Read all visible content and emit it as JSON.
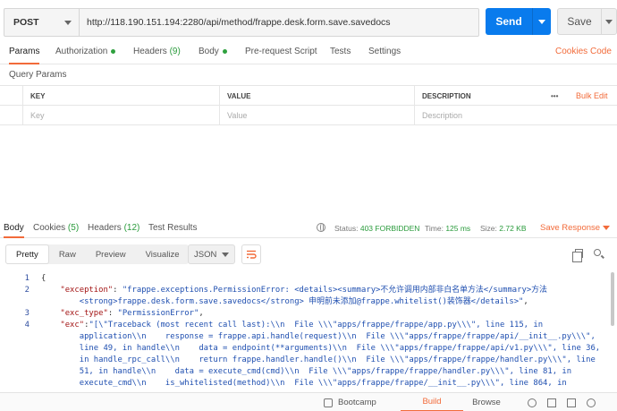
{
  "request": {
    "method": "POST",
    "url": "http://118.190.151.194:2280/api/method/frappe.desk.form.save.savedocs",
    "send_label": "Send",
    "save_label": "Save"
  },
  "request_tabs": [
    {
      "label": "Params",
      "count": "",
      "dot": false
    },
    {
      "label": "Authorization",
      "count": "",
      "dot": true
    },
    {
      "label": "Headers",
      "count": "(9)",
      "dot": false
    },
    {
      "label": "Body",
      "count": "",
      "dot": true
    },
    {
      "label": "Pre-request Script",
      "count": "",
      "dot": false
    },
    {
      "label": "Tests",
      "count": "",
      "dot": false
    },
    {
      "label": "Settings",
      "count": "",
      "dot": false
    }
  ],
  "request_links": {
    "cookies": "Cookies",
    "code": "Code"
  },
  "query_params": {
    "section_label": "Query Params",
    "headers": {
      "key": "KEY",
      "value": "VALUE",
      "description": "DESCRIPTION",
      "more": "•••",
      "bulk_edit": "Bulk Edit"
    },
    "placeholders": {
      "key": "Key",
      "value": "Value",
      "description": "Description"
    }
  },
  "response_tabs": [
    {
      "label": "Body",
      "count": ""
    },
    {
      "label": "Cookies",
      "count": "(5)"
    },
    {
      "label": "Headers",
      "count": "(12)"
    },
    {
      "label": "Test Results",
      "count": ""
    }
  ],
  "response_status": {
    "status_label": "Status:",
    "status_value": "403 FORBIDDEN",
    "time_label": "Time:",
    "time_value": "125 ms",
    "size_label": "Size:",
    "size_value": "2.72 KB",
    "save_response": "Save Response"
  },
  "view_modes": [
    "Pretty",
    "Raw",
    "Preview",
    "Visualize"
  ],
  "format": "JSON",
  "code_lines": [
    {
      "num": "1",
      "segs": [
        {
          "t": "{",
          "c": "brace"
        }
      ]
    },
    {
      "num": "2",
      "segs": [
        {
          "t": "    \"exception\"",
          "c": "k"
        },
        {
          "t": ": ",
          "c": "p"
        },
        {
          "t": "\"frappe.exceptions.PermissionError: <details><summary>不允许调用内部非白名单方法</summary>方法",
          "c": "s"
        }
      ]
    },
    {
      "num": "",
      "segs": [
        {
          "t": "        <strong>frappe.desk.form.save.savedocs</strong> 申明前未添加@frappe.whitelist()装饰器</details>\"",
          "c": "s"
        },
        {
          "t": ",",
          "c": "p"
        }
      ]
    },
    {
      "num": "3",
      "segs": [
        {
          "t": "    \"exc_type\"",
          "c": "k"
        },
        {
          "t": ": ",
          "c": "p"
        },
        {
          "t": "\"PermissionError\"",
          "c": "s"
        },
        {
          "t": ",",
          "c": "p"
        }
      ]
    },
    {
      "num": "4",
      "segs": [
        {
          "t": "    \"exc\"",
          "c": "k"
        },
        {
          "t": ":",
          "c": "p"
        },
        {
          "t": "\"[\\\"Traceback (most recent call last):\\\\n  File \\\\\\\"apps/frappe/frappe/app.py\\\\\\\", line 115, in",
          "c": "s"
        }
      ]
    },
    {
      "num": "",
      "segs": [
        {
          "t": "        application\\\\n    response = frappe.api.handle(request)\\\\n  File \\\\\\\"apps/frappe/frappe/api/__init__.py\\\\\\\",",
          "c": "s"
        }
      ]
    },
    {
      "num": "",
      "segs": [
        {
          "t": "        line 49, in handle\\\\n    data = endpoint(**arguments)\\\\n  File \\\\\\\"apps/frappe/frappe/api/v1.py\\\\\\\", line 36,",
          "c": "s"
        }
      ]
    },
    {
      "num": "",
      "segs": [
        {
          "t": "        in handle_rpc_call\\\\n    return frappe.handler.handle()\\\\n  File \\\\\\\"apps/frappe/frappe/handler.py\\\\\\\", line",
          "c": "s"
        }
      ]
    },
    {
      "num": "",
      "segs": [
        {
          "t": "        51, in handle\\\\n    data = execute_cmd(cmd)\\\\n  File \\\\\\\"apps/frappe/frappe/handler.py\\\\\\\", line 81, in",
          "c": "s"
        }
      ]
    },
    {
      "num": "",
      "segs": [
        {
          "t": "        execute_cmd\\\\n    is_whitelisted(method)\\\\n  File \\\\\\\"apps/frappe/frappe/__init__.py\\\\\\\", line 864, in",
          "c": "s"
        }
      ]
    }
  ],
  "bottom_bar": {
    "bootcamp": "Bootcamp",
    "build": "Build",
    "browse": "Browse"
  },
  "colors": {
    "accent": "#f26b3a",
    "send": "#097bed",
    "success": "#2a9b3c",
    "error": "#f26b3a"
  }
}
